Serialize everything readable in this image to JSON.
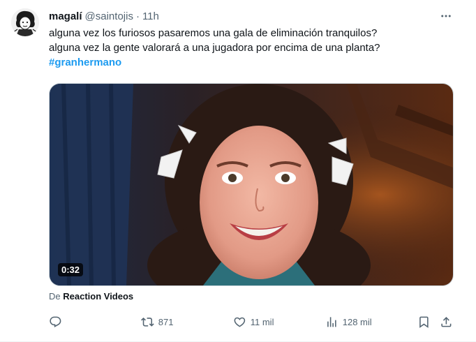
{
  "tweet": {
    "author": {
      "display_name": "magalí",
      "handle": "@saintojis",
      "separator": "·",
      "time": "11h"
    },
    "text": {
      "line1": "alguna vez los furiosos pasaremos una gala de eliminación tranquilos?",
      "line2": "alguna vez la gente valorará a una jugadora por encima de una planta?",
      "hashtag": "#granhermano"
    },
    "media": {
      "type": "video",
      "duration": "0:32"
    },
    "source": {
      "prefix": "De",
      "name": "Reaction Videos"
    },
    "actions": {
      "reply": {
        "icon": "reply-icon",
        "count": ""
      },
      "retweet": {
        "icon": "retweet-icon",
        "count": "871"
      },
      "like": {
        "icon": "heart-icon",
        "count": "11 mil"
      },
      "views": {
        "icon": "views-icon",
        "count": "128 mil"
      },
      "bookmark": {
        "icon": "bookmark-icon"
      },
      "share": {
        "icon": "share-icon"
      }
    },
    "colors": {
      "text_primary": "#0f1419",
      "text_secondary": "#536471",
      "accent": "#1d9bf0"
    }
  }
}
